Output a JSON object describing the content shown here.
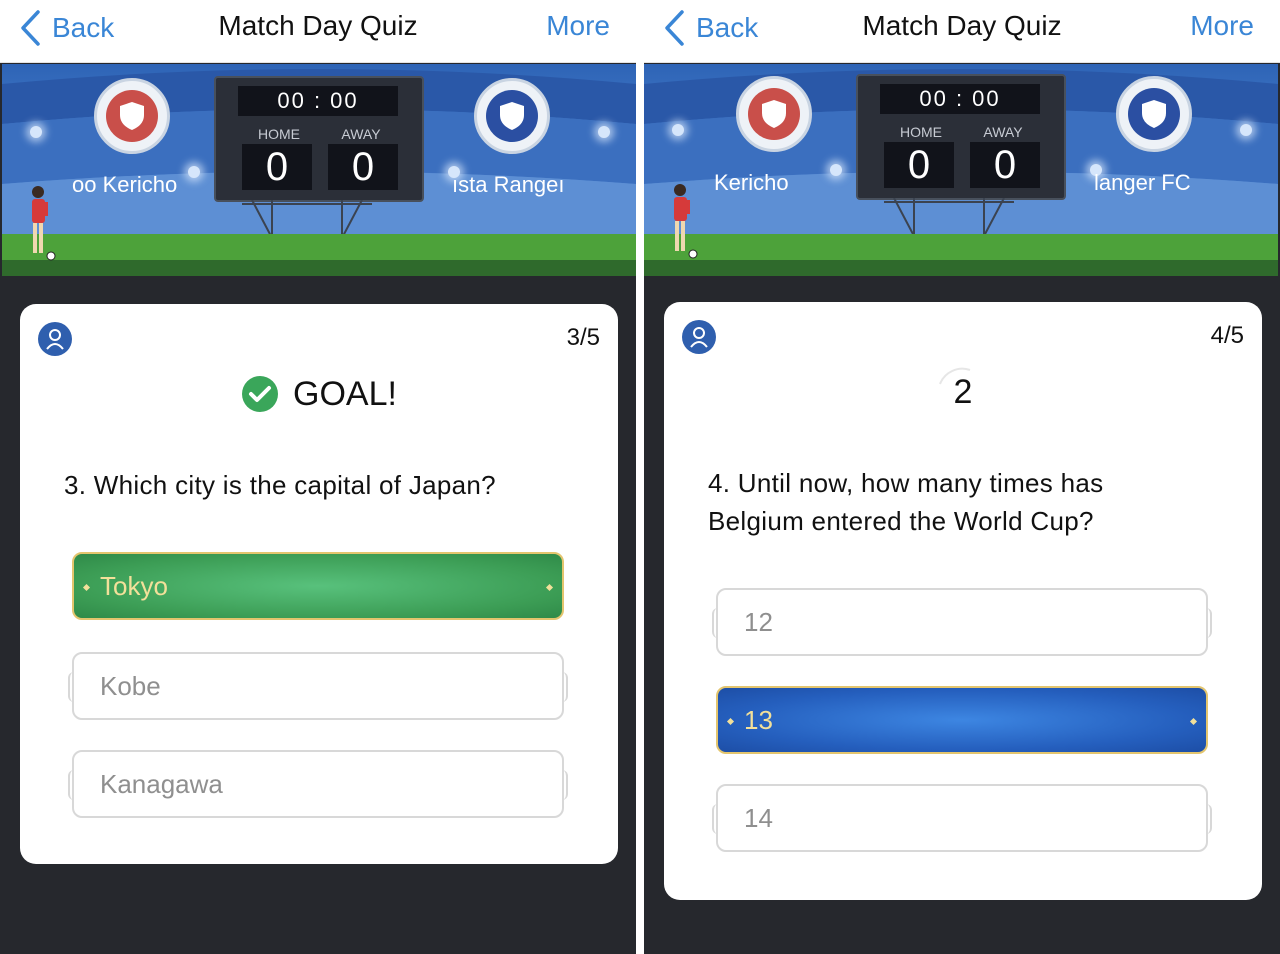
{
  "colors": {
    "link": "#3a86d6",
    "correct_option": "#3c9d55",
    "selected_option": "#255fbe",
    "option_gold_text": "#f2e09a",
    "home_badge": "#c94f4a",
    "away_badge": "#2b4fa2"
  },
  "screens": [
    {
      "nav": {
        "back_label": "Back",
        "title": "Match Day Quiz",
        "more_label": "More"
      },
      "stadium": {
        "home_team": "oo Kericho",
        "away_team": "ısta Rangeı",
        "time": "00 : 00",
        "home_label": "HOME",
        "away_label": "AWAY",
        "home_score": "0",
        "away_score": "0"
      },
      "quiz": {
        "progress": "3/5",
        "status_icon": "check-circle-icon",
        "status_text": "GOAL!",
        "question": "3. Which city is the capital of Japan?",
        "options": [
          {
            "label": "Tokyo",
            "state": "correct"
          },
          {
            "label": "Kobe",
            "state": "default"
          },
          {
            "label": "Kanagawa",
            "state": "default"
          }
        ]
      }
    },
    {
      "nav": {
        "back_label": "Back",
        "title": "Match Day Quiz",
        "more_label": "More"
      },
      "stadium": {
        "home_team": "Kericho",
        "away_team": "langer FC",
        "time": "00 : 00",
        "home_label": "HOME",
        "away_label": "AWAY",
        "home_score": "0",
        "away_score": "0"
      },
      "quiz": {
        "progress": "4/5",
        "countdown": "2",
        "question_line1": "4. Until now, how many times has",
        "question_line2": "Belgium entered the World Cup?",
        "options": [
          {
            "label": "12",
            "state": "default"
          },
          {
            "label": "13",
            "state": "selected"
          },
          {
            "label": "14",
            "state": "default"
          }
        ]
      }
    }
  ]
}
